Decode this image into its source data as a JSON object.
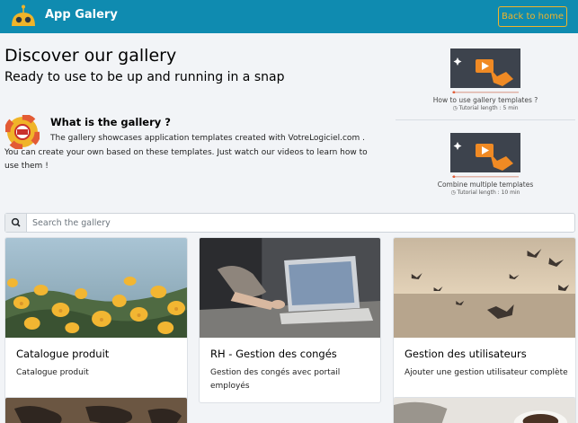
{
  "header": {
    "app_title": "App Galery",
    "home_button": "Back to home",
    "logo_icon": "robot-logo-icon"
  },
  "intro": {
    "title": "Discover our gallery",
    "subtitle": "Ready to use to be up and running in a snap",
    "what_title": "What is the gallery ?",
    "what_desc": "The gallery showcases application templates created with VotreLogiciel.com . You can create your own based on these templates. Just watch our videos to learn how to use them !"
  },
  "videos": [
    {
      "title": "How to use gallery templates ?",
      "length": "Tutorial length : 5 min"
    },
    {
      "title": "Combine multiple templates",
      "length": "Tutorial length : 10 min"
    }
  ],
  "search": {
    "placeholder": "Search the gallery"
  },
  "cards": [
    {
      "title": "Catalogue produit",
      "desc": "Catalogue produit"
    },
    {
      "title": "RH - Gestion des congés",
      "desc": "Gestion des congés avec portail employés"
    },
    {
      "title": "Gestion des utilisateurs",
      "desc": "Ajouter une gestion utilisateur complète"
    }
  ],
  "colors": {
    "header_bg": "#0f8bb0",
    "accent": "#f0b429",
    "page_bg": "#f2f4f7"
  }
}
